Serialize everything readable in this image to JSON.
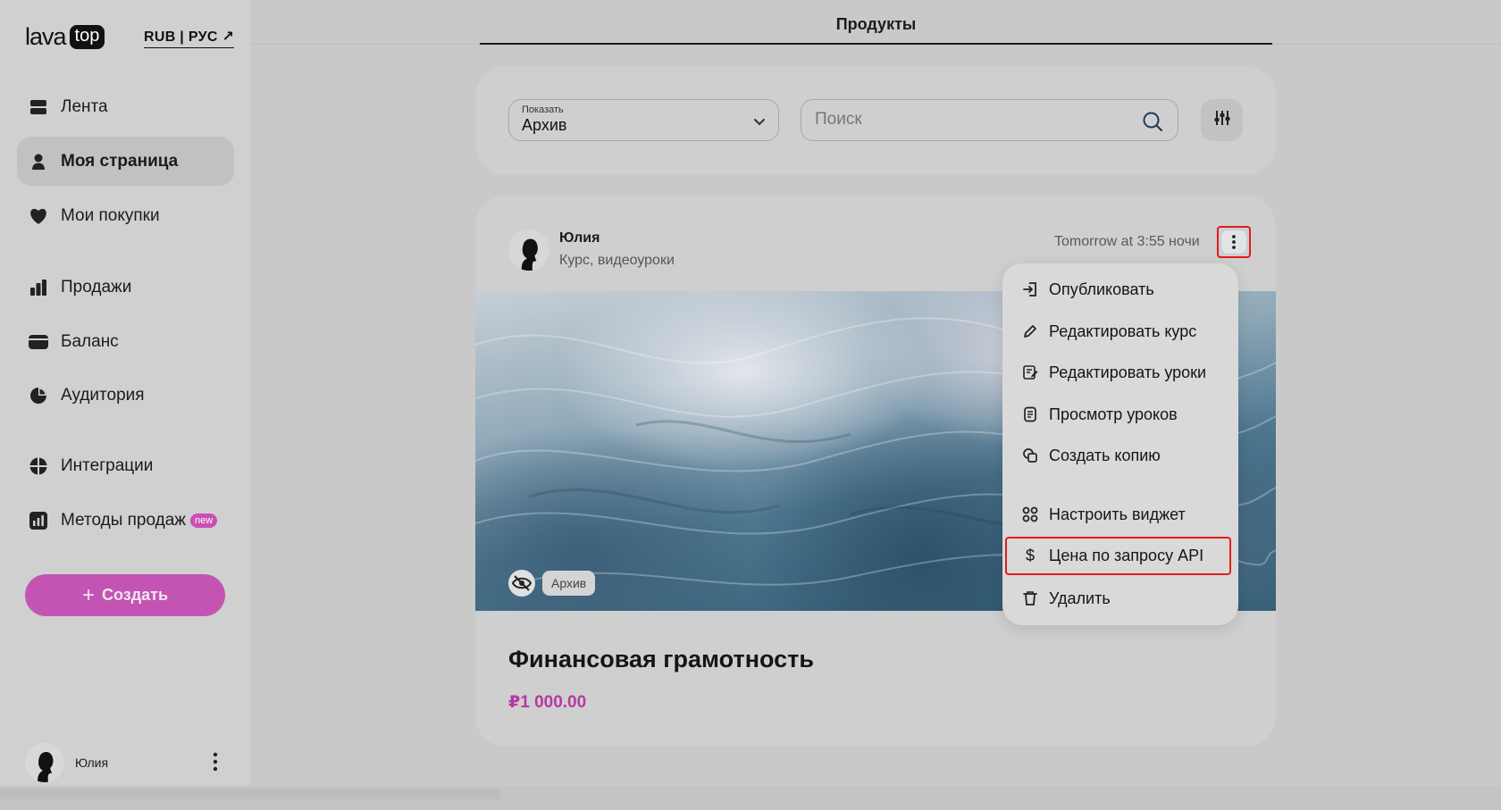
{
  "logo": {
    "part1": "lava",
    "part2": "top"
  },
  "currency_link": "RUB | РУС ↗",
  "sidebar": {
    "items": [
      {
        "label": "Лента",
        "icon": "feed-icon"
      },
      {
        "label": "Моя страница",
        "icon": "person-icon",
        "active": true
      },
      {
        "label": "Мои покупки",
        "icon": "heart-icon"
      },
      {
        "label": "Продажи",
        "icon": "bar-chart-icon"
      },
      {
        "label": "Баланс",
        "icon": "wallet-icon"
      },
      {
        "label": "Аудитория",
        "icon": "pie-chart-icon"
      },
      {
        "label": "Интеграции",
        "icon": "integrations-icon"
      },
      {
        "label": "Методы продаж",
        "icon": "sales-methods-icon",
        "badge": "new"
      }
    ],
    "create_button": "Создать",
    "user_name": "Юлия"
  },
  "header": {
    "tab": "Продукты"
  },
  "filters": {
    "show_label": "Показать",
    "show_value": "Архив",
    "search_placeholder": "Поиск"
  },
  "product": {
    "author": "Юлия",
    "type": "Курс, видеоуроки",
    "timestamp": "Tomorrow at 3:55 ночи",
    "status_badge": "Архив",
    "title": "Финансовая грамотность",
    "price": "₽1 000.00"
  },
  "menu": {
    "items": [
      "Опубликовать",
      "Редактировать курс",
      "Редактировать уроки",
      "Просмотр уроков",
      "Создать копию",
      "Настроить виджет",
      "Цена по запросу API",
      "Удалить"
    ]
  },
  "colors": {
    "accent": "#c454b3",
    "price": "#b53aa1",
    "highlight": "#e21b1b"
  }
}
